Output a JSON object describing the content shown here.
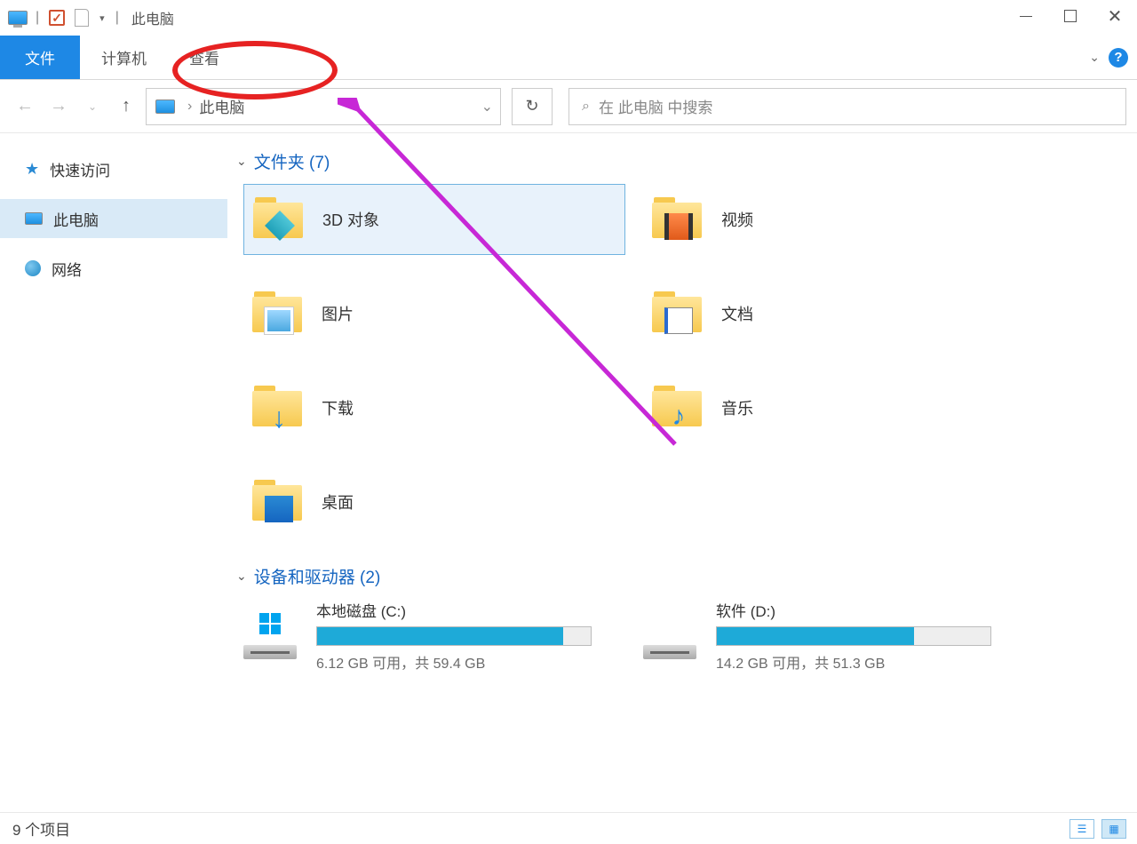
{
  "titlebar": {
    "title": "此电脑"
  },
  "ribbon": {
    "file": "文件",
    "computer": "计算机",
    "view": "查看"
  },
  "address": {
    "location": "此电脑"
  },
  "search": {
    "placeholder": "在 此电脑 中搜索"
  },
  "sidebar": {
    "quick_access": "快速访问",
    "this_pc": "此电脑",
    "network": "网络"
  },
  "groups": {
    "folders": {
      "label": "文件夹",
      "count": 7
    },
    "devices": {
      "label": "设备和驱动器",
      "count": 2
    }
  },
  "folders": {
    "objects3d": "3D 对象",
    "videos": "视频",
    "pictures": "图片",
    "documents": "文档",
    "downloads": "下载",
    "music": "音乐",
    "desktop": "桌面"
  },
  "drives": {
    "c": {
      "name": "本地磁盘 (C:)",
      "free_text": "6.12 GB 可用，共 59.4 GB",
      "fill_percent": 90
    },
    "d": {
      "name": "软件 (D:)",
      "free_text": "14.2 GB 可用，共 51.3 GB",
      "fill_percent": 72
    }
  },
  "statusbar": {
    "count_text": "9 个项目"
  }
}
